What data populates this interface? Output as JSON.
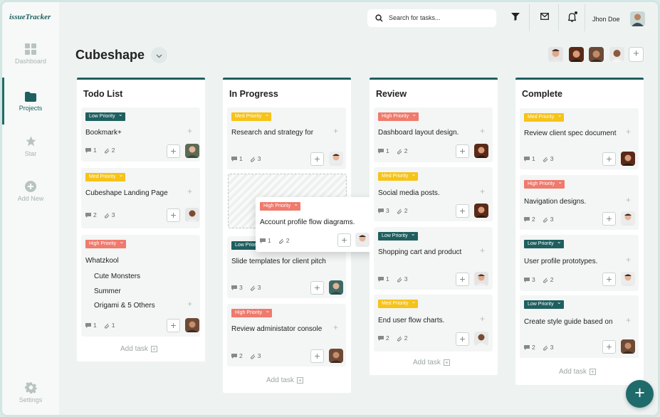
{
  "app": {
    "logo": "issueTracker"
  },
  "sidebar": {
    "items": [
      {
        "label": "Dashboard",
        "icon": "dashboard-icon"
      },
      {
        "label": "Projects",
        "icon": "folder-icon",
        "active": true
      },
      {
        "label": "Star",
        "icon": "star-icon"
      },
      {
        "label": "Add New",
        "icon": "add-circle-icon"
      },
      {
        "label": "Settings",
        "icon": "gear-icon"
      }
    ]
  },
  "header": {
    "search_placeholder": "Search for tasks...",
    "user_name": "Jhon Doe"
  },
  "project": {
    "title": "Cubeshape"
  },
  "columns": [
    {
      "title": "Todo List",
      "add_task": "Add task",
      "cards": [
        {
          "priority": "Low Priority",
          "title": "Bookmark+",
          "comments": "1",
          "attachments": "2"
        },
        {
          "priority": "Med Priority",
          "title": "Cubeshape Landing Page",
          "comments": "2",
          "attachments": "3"
        },
        {
          "priority": "High Priority",
          "title": "Whatzkool",
          "subitems": [
            "Cute Monsters",
            "Summer",
            "Origami & 5 Others"
          ],
          "comments": "1",
          "attachments": "1"
        }
      ]
    },
    {
      "title": "In Progress",
      "add_task": "Add task",
      "cards": [
        {
          "priority": "Med Priority",
          "title": "Research and strategy for",
          "comments": "1",
          "attachments": "3"
        },
        {
          "priority": "Low Priority",
          "title": "Slide templates for client pitch",
          "comments": "3",
          "attachments": "3"
        },
        {
          "priority": "High Priority",
          "title": "Review administator console",
          "comments": "2",
          "attachments": "3"
        }
      ],
      "dragging": {
        "priority": "High Priority",
        "title": "Account profile flow diagrams.",
        "comments": "1",
        "attachments": "2"
      }
    },
    {
      "title": "Review",
      "add_task": "Add task",
      "cards": [
        {
          "priority": "High Priority",
          "title": "Dashboard layout design.",
          "comments": "1",
          "attachments": "2"
        },
        {
          "priority": "Med Priority",
          "title": "Social media posts.",
          "comments": "3",
          "attachments": "2"
        },
        {
          "priority": "Low Priority",
          "title": "Shopping cart and product",
          "comments": "1",
          "attachments": "3"
        },
        {
          "priority": "Med Priority",
          "title": "End user flow charts.",
          "comments": "2",
          "attachments": "2"
        }
      ]
    },
    {
      "title": "Complete",
      "add_task": "Add task",
      "cards": [
        {
          "priority": "Med Priority",
          "title": "Review client spec document",
          "comments": "1",
          "attachments": "3"
        },
        {
          "priority": "High Priority",
          "title": "Navigation designs.",
          "comments": "2",
          "attachments": "3"
        },
        {
          "priority": "Low Priority",
          "title": "User profile prototypes.",
          "comments": "3",
          "attachments": "2"
        },
        {
          "priority": "Low Priority",
          "title": "Create style guide based on",
          "comments": "2",
          "attachments": "3"
        }
      ]
    }
  ],
  "colors": {
    "brand": "#1f5f5f",
    "low": "#1f5f5f",
    "med": "#f6c318",
    "high": "#ef7a6d",
    "fab": "#1f6b6b"
  }
}
